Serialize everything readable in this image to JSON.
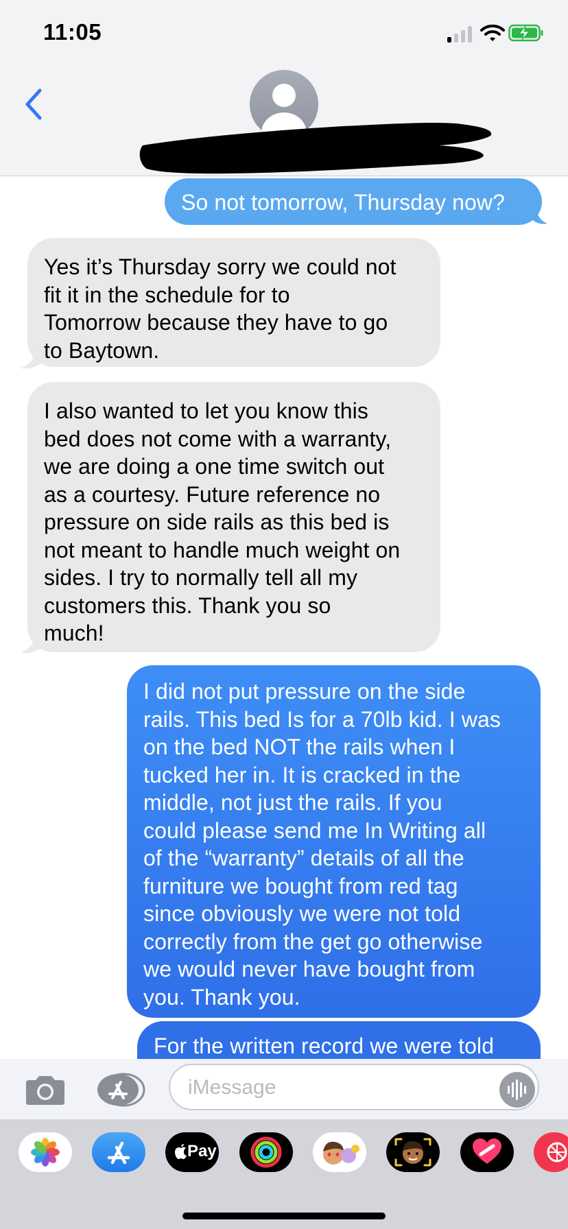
{
  "status_bar": {
    "time": "11:05",
    "signal_bars": 2,
    "battery": "charging"
  },
  "header": {
    "back_icon": "chevron-left-icon",
    "avatar_icon": "person-placeholder-icon",
    "contact_name_redacted": true
  },
  "messages": [
    {
      "direction": "outgoing",
      "style": "sms",
      "text": "So not tomorrow, Thursday now?"
    },
    {
      "direction": "incoming",
      "text": "Yes it’s Thursday sorry we could not\nfit it in the schedule for to\nTomorrow because they have to go\nto Baytown."
    },
    {
      "direction": "incoming",
      "text": "I also wanted to let you know this\nbed does not come with a warranty,\nwe are doing a one time switch out\nas a courtesy.  Future reference no\npressure on side rails as this bed is\nnot meant to handle much weight on\nsides.  I try to normally tell all my\ncustomers this.  Thank you so\nmuch!"
    },
    {
      "direction": "outgoing",
      "style": "imessage",
      "text": "I did not put pressure on the side\nrails. This bed Is for a 70lb kid. I was\non the bed NOT the rails when I\ntucked her in.  It is cracked in the\nmiddle, not just the rails. If you\ncould please send me In Writing all\nof the “warranty” details of all the\nfurniture we bought from red tag\nsince obviously we were not told\ncorrectly from the get go otherwise\nwe would never have bought from\nyou. Thank you."
    },
    {
      "direction": "outgoing",
      "style": "imessage",
      "text": "For the written record we were told"
    }
  ],
  "composer": {
    "placeholder": "iMessage",
    "camera_icon": "camera-icon",
    "apps_icon": "app-store-icon",
    "voice_icon": "waveform-icon"
  },
  "app_drawer": {
    "apple_pay_label": "Pay",
    "apps": [
      "photos-icon",
      "app-store-icon",
      "apple-pay-icon",
      "activity-rings-icon",
      "memoji-stickers-icon",
      "memoji-icon",
      "digital-touch-icon",
      "search-images-icon"
    ]
  },
  "colors": {
    "incoming_bubble": "#e9e9eb",
    "sms_bubble": "#5aa8f0",
    "imessage_bubble_top": "#3e8ef6",
    "imessage_bubble_bottom": "#2f6fe8",
    "accent_blue": "#3b7ff0"
  }
}
